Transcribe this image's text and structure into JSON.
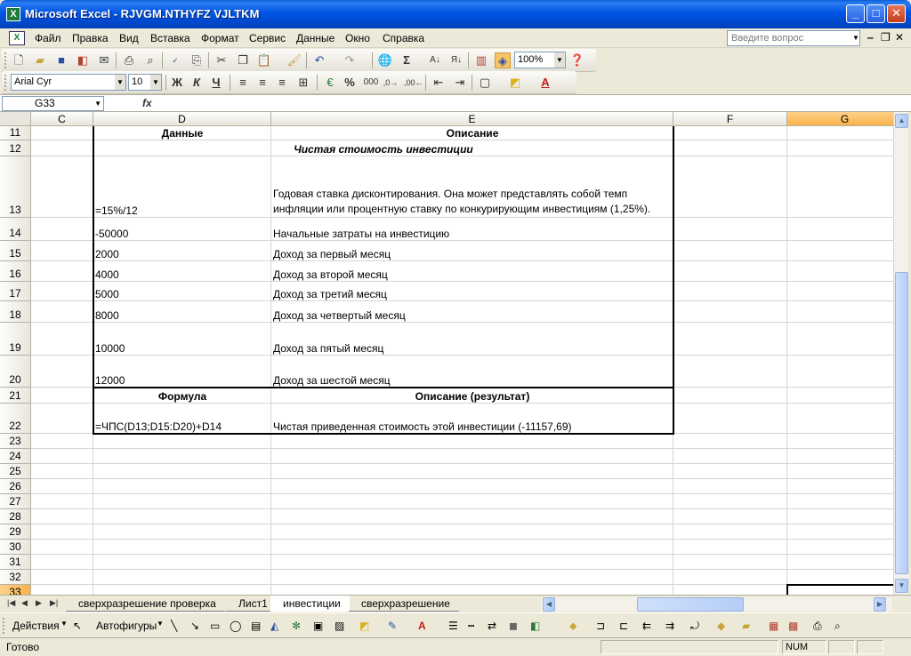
{
  "window": {
    "title": "Microsoft Excel - RJVGM.NTHYFZ VJLTKM",
    "minimize": "_",
    "maximize": "□",
    "close": "✕"
  },
  "menu": {
    "items": [
      "Файл",
      "Правка",
      "Вид",
      "Вставка",
      "Формат",
      "Сервис",
      "Данные",
      "Окно",
      "Справка"
    ],
    "ask_placeholder": "Введите вопрос",
    "doc_min": "‒",
    "doc_restore": "❐",
    "doc_close": "✕"
  },
  "toolbar": {
    "zoom": "100%",
    "font_name": "Arial Cyr",
    "font_size": "10",
    "bold": "Ж",
    "italic": "К",
    "underline": "Ч",
    "percent": "%",
    "thousands": "000",
    "sum": "Σ"
  },
  "formula_bar": {
    "name_box": "G33",
    "fx": "fx",
    "content": ""
  },
  "columns": [
    "C",
    "D",
    "E",
    "F",
    "G"
  ],
  "selected_column": "G",
  "rows": [
    "11",
    "12",
    "13",
    "14",
    "15",
    "16",
    "17",
    "18",
    "19",
    "20",
    "21",
    "22",
    "23",
    "24",
    "25",
    "26",
    "27",
    "28",
    "29",
    "30",
    "31",
    "32",
    "33"
  ],
  "selected_row": "33",
  "cells": {
    "D11": "Данные",
    "E11": "Описание",
    "E12": "Чистая стоимость инвестиции",
    "D13": "=15%/12",
    "E13": "Годовая ставка дисконтирования. Она может представлять собой темп инфляции или процентную ставку по конкурирующим инвестициям (1,25%).",
    "D14": "-50000",
    "E14": "Начальные затраты на инвестицию",
    "D15": "2000",
    "E15": "Доход за первый месяц",
    "D16": "4000",
    "E16": "Доход за второй месяц",
    "D17": "5000",
    "E17": "Доход за третий месяц",
    "D18": "8000",
    "E18": "Доход за четвертый месяц",
    "D19": "10000",
    "E19": "Доход за пятый месяц",
    "D20": "12000",
    "E20": "Доход за шестой месяц",
    "D21": "Формула",
    "E21": "Описание (результат)",
    "D22": "=ЧПС(D13;D15:D20)+D14",
    "E22": "Чистая приведенная стоимость этой инвестиции (-11157,69)"
  },
  "sheet_tabs": [
    "сверхразрешение проверка",
    "Лист1",
    "инвестиции",
    "сверхразрешение"
  ],
  "active_sheet": "инвестиции",
  "drawing_toolbar": {
    "actions": "Действия",
    "autoshapes": "Автофигуры"
  },
  "status": {
    "text": "Готово",
    "num": "NUM"
  }
}
